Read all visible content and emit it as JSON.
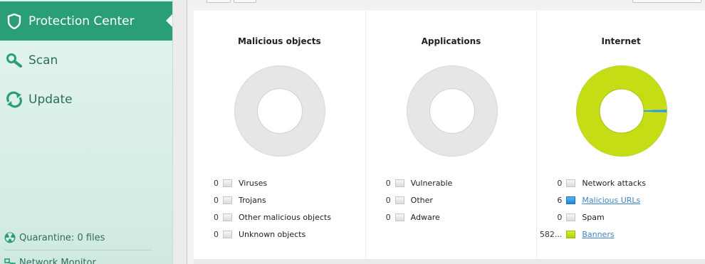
{
  "sidebar": {
    "items": [
      {
        "label": "Protection Center",
        "icon": "shield-icon",
        "active": true
      },
      {
        "label": "Scan",
        "icon": "magnifier-icon",
        "active": false
      },
      {
        "label": "Update",
        "icon": "refresh-icon",
        "active": false
      }
    ],
    "quarantine": "Quarantine: 0 files",
    "network_monitor": "Network Monitor"
  },
  "colors": {
    "accent": "#2a9d79",
    "sidebar_bg": "#dbf0ea",
    "donut_empty": "#e6e6e6",
    "internet_green": "#c4dd14",
    "internet_blue": "#2d9be4"
  },
  "panels": [
    {
      "title": "Malicious objects",
      "stats": [
        {
          "value": "0",
          "label": "Viruses"
        },
        {
          "value": "0",
          "label": "Trojans"
        },
        {
          "value": "0",
          "label": "Other malicious objects"
        },
        {
          "value": "0",
          "label": "Unknown objects"
        }
      ]
    },
    {
      "title": "Applications",
      "stats": [
        {
          "value": "0",
          "label": "Vulnerable"
        },
        {
          "value": "0",
          "label": "Other"
        },
        {
          "value": "0",
          "label": "Adware"
        }
      ]
    },
    {
      "title": "Internet",
      "stats": [
        {
          "value": "0",
          "label": "Network attacks"
        },
        {
          "value": "6",
          "label": "Malicious URLs"
        },
        {
          "value": "0",
          "label": "Spam"
        },
        {
          "value": "582...",
          "label": "Banners"
        }
      ]
    }
  ],
  "chart_data": {
    "type": "pie",
    "labels": [
      "Malicious URLs",
      "Banners"
    ],
    "values": [
      6,
      582
    ],
    "colors": [
      "#2d9be4",
      "#c4dd14"
    ]
  }
}
